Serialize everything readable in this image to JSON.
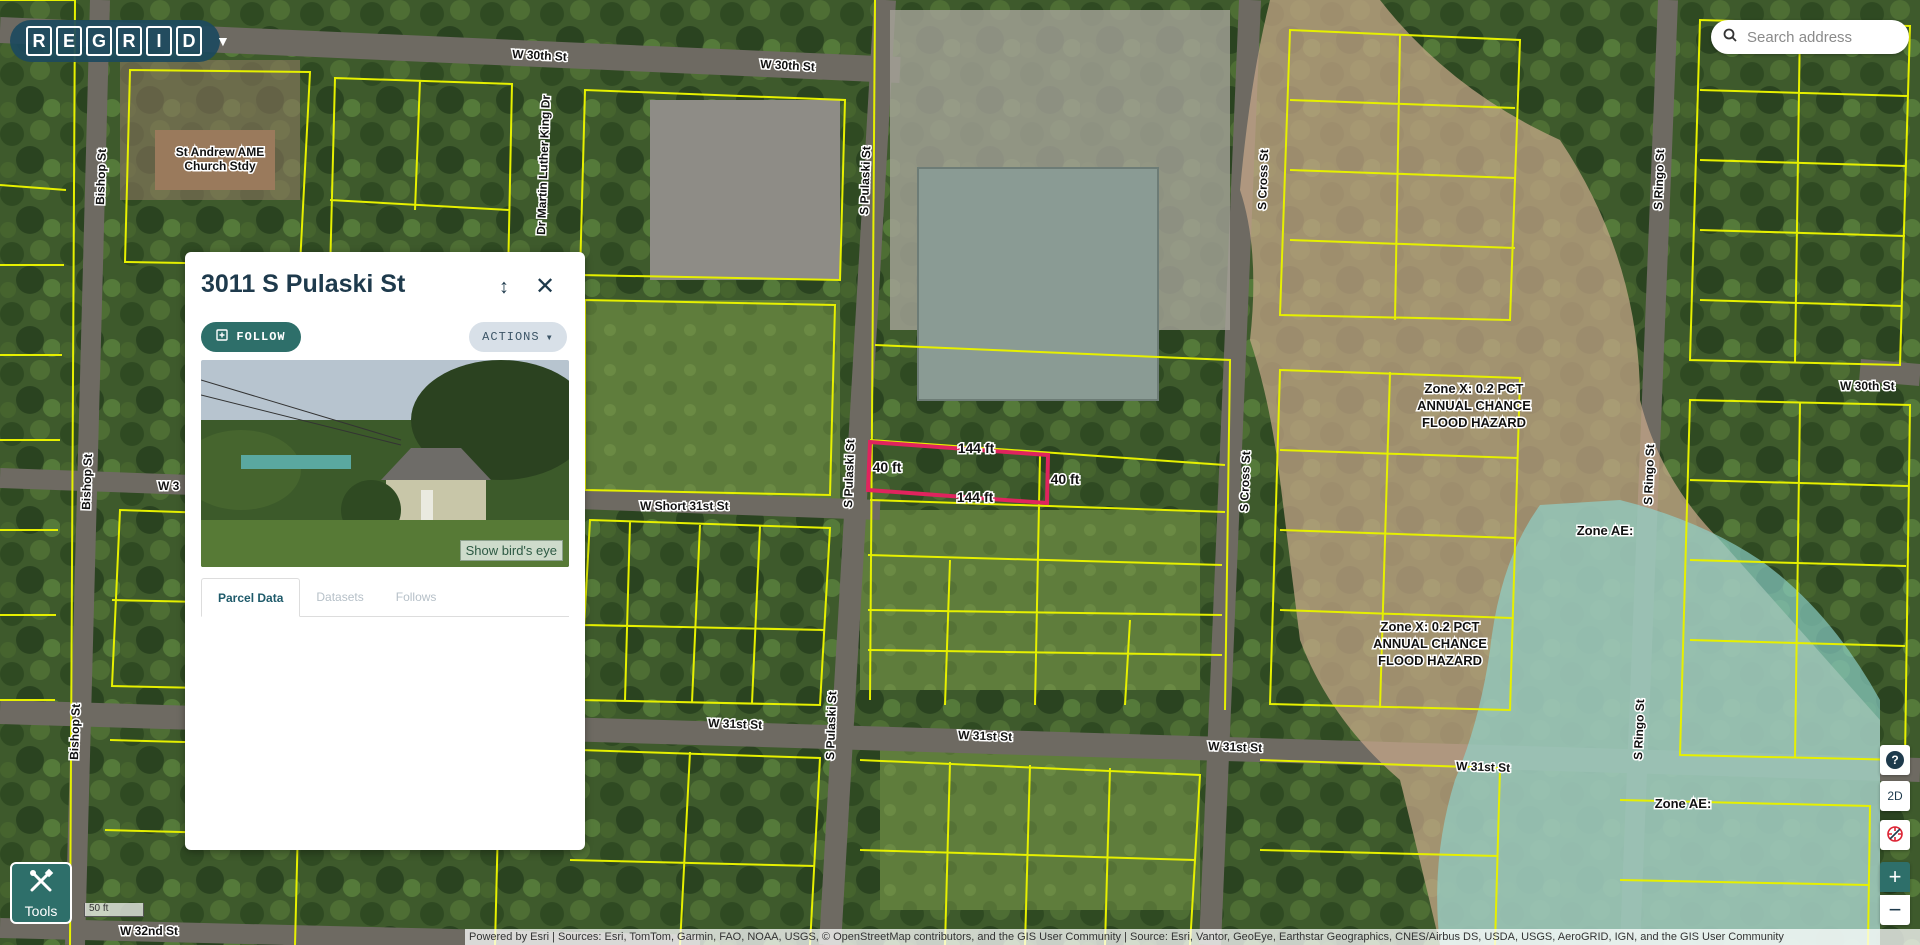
{
  "app": {
    "brand": "REGRID"
  },
  "search": {
    "placeholder": "Search address"
  },
  "panel": {
    "title": "3011 S Pulaski St",
    "follow_label": "FOLLOW",
    "actions_label": "ACTIONS",
    "birds_eye_label": "Show bird's eye",
    "tabs": [
      {
        "label": "Parcel Data",
        "active": true
      },
      {
        "label": "Datasets",
        "active": false
      },
      {
        "label": "Follows",
        "active": false
      }
    ]
  },
  "map": {
    "street_labels": [
      "W 30th St",
      "W 30th St",
      "W 30th St",
      "Bishop St",
      "Bishop St",
      "Bishop St",
      "Dr Martin Luther King Dr",
      "S Pulaski St",
      "S Pulaski St",
      "S Pulaski St",
      "S Cross St",
      "S Cross St",
      "S Ringo St",
      "S Ringo St",
      "S Ringo St",
      "W Short 31st St",
      "W 3",
      "W 31st St",
      "W 31st St",
      "W 31st St",
      "W 31st St",
      "W 32nd St"
    ],
    "poi_labels": [
      "St Andrew AME",
      "Church Stdy"
    ],
    "flood_zones": [
      {
        "label_lines": [
          "Zone X: 0.2 PCT",
          "ANNUAL CHANCE",
          "FLOOD HAZARD"
        ]
      },
      {
        "label_lines": [
          "Zone X: 0.2 PCT",
          "ANNUAL CHANCE",
          "FLOOD HAZARD"
        ]
      },
      {
        "label_lines": [
          "Zone AE:"
        ]
      },
      {
        "label_lines": [
          "Zone AE:"
        ]
      }
    ],
    "selected_parcel": {
      "dimensions": [
        "144 ft",
        "144 ft",
        "40 ft",
        "40 ft"
      ]
    },
    "colors": {
      "parcel_lines": "#e6f000",
      "selected_parcel": "#e0245e",
      "flood_x": "#c9a98a",
      "flood_ae": "#8fd6d0"
    }
  },
  "controls": {
    "help": "?",
    "view_mode": "2D",
    "zoom_in": "+",
    "zoom_out": "−",
    "tools_label": "Tools",
    "scale_label": "50 ft"
  },
  "attribution": "Powered by Esri | Sources: Esri, TomTom, Garmin, FAO, NOAA, USGS, © OpenStreetMap contributors, and the GIS User Community | Source: Esri, Vantor, GeoEye, Earthstar Geographics, CNES/Airbus DS, USDA, USGS, AeroGRID, IGN, and the GIS User Community"
}
